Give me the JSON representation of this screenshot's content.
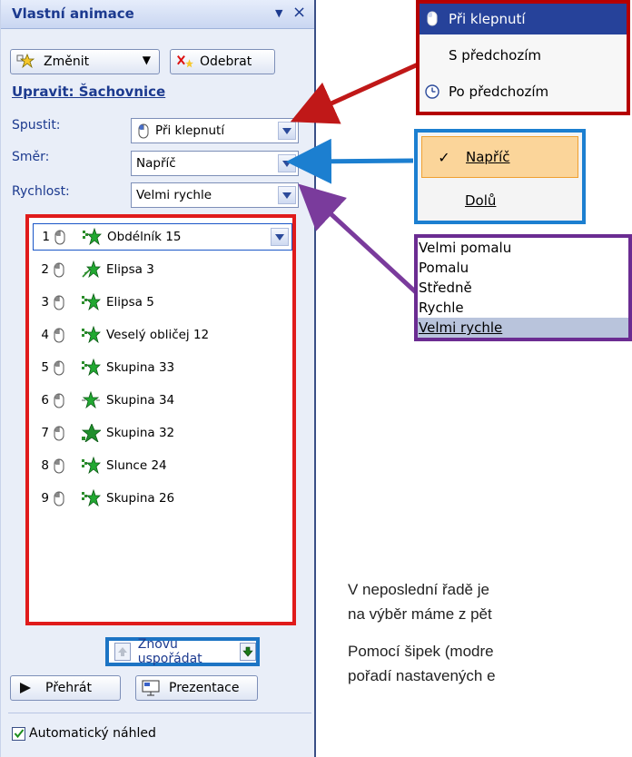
{
  "pane": {
    "title": "Vlastní animace",
    "change_button": "Změnit",
    "remove_button": "Odebrat",
    "section_title": "Upravit: Šachovnice",
    "fields": [
      {
        "label": "Spustit:",
        "value": "Při klepnutí"
      },
      {
        "label": "Směr:",
        "value": "Napříč"
      },
      {
        "label": "Rychlost:",
        "value": "Velmi rychle"
      }
    ],
    "animations": [
      {
        "num": "1",
        "name": "Obdélník 15"
      },
      {
        "num": "2",
        "name": "Elipsa 3"
      },
      {
        "num": "3",
        "name": "Elipsa 5"
      },
      {
        "num": "4",
        "name": "Veselý obličej 12"
      },
      {
        "num": "5",
        "name": "Skupina 33"
      },
      {
        "num": "6",
        "name": "Skupina 34"
      },
      {
        "num": "7",
        "name": "Skupina 32"
      },
      {
        "num": "8",
        "name": "Slunce 24"
      },
      {
        "num": "9",
        "name": "Skupina 26"
      }
    ],
    "reorder_label": "Znovu uspořádat",
    "play_button": "Přehrát",
    "slideshow_button": "Prezentace",
    "autopreview_label": "Automatický náhled"
  },
  "start_menu": {
    "items": [
      "Při klepnutí",
      "S předchozím",
      "Po předchozím"
    ],
    "selected": "Při klepnutí"
  },
  "direction_menu": {
    "items": [
      "Napříč",
      "Dolů"
    ],
    "selected": "Napříč"
  },
  "speed_menu": {
    "items": [
      "Velmi pomalu",
      "Pomalu",
      "Středně",
      "Rychle",
      "Velmi rychle"
    ],
    "selected": "Velmi rychle"
  },
  "text": {
    "line1": "V neposlední řadě je",
    "line2": "na výběr máme z pět",
    "line3": "Pomocí šipek (modre",
    "line4": "pořadí nastavených e"
  },
  "colors": {
    "pane_title": "#1c3a8f",
    "list_border": "#e01b1b",
    "start_border": "#b50000",
    "direction_border": "#1c7fd0",
    "speed_border": "#6b2c92"
  }
}
